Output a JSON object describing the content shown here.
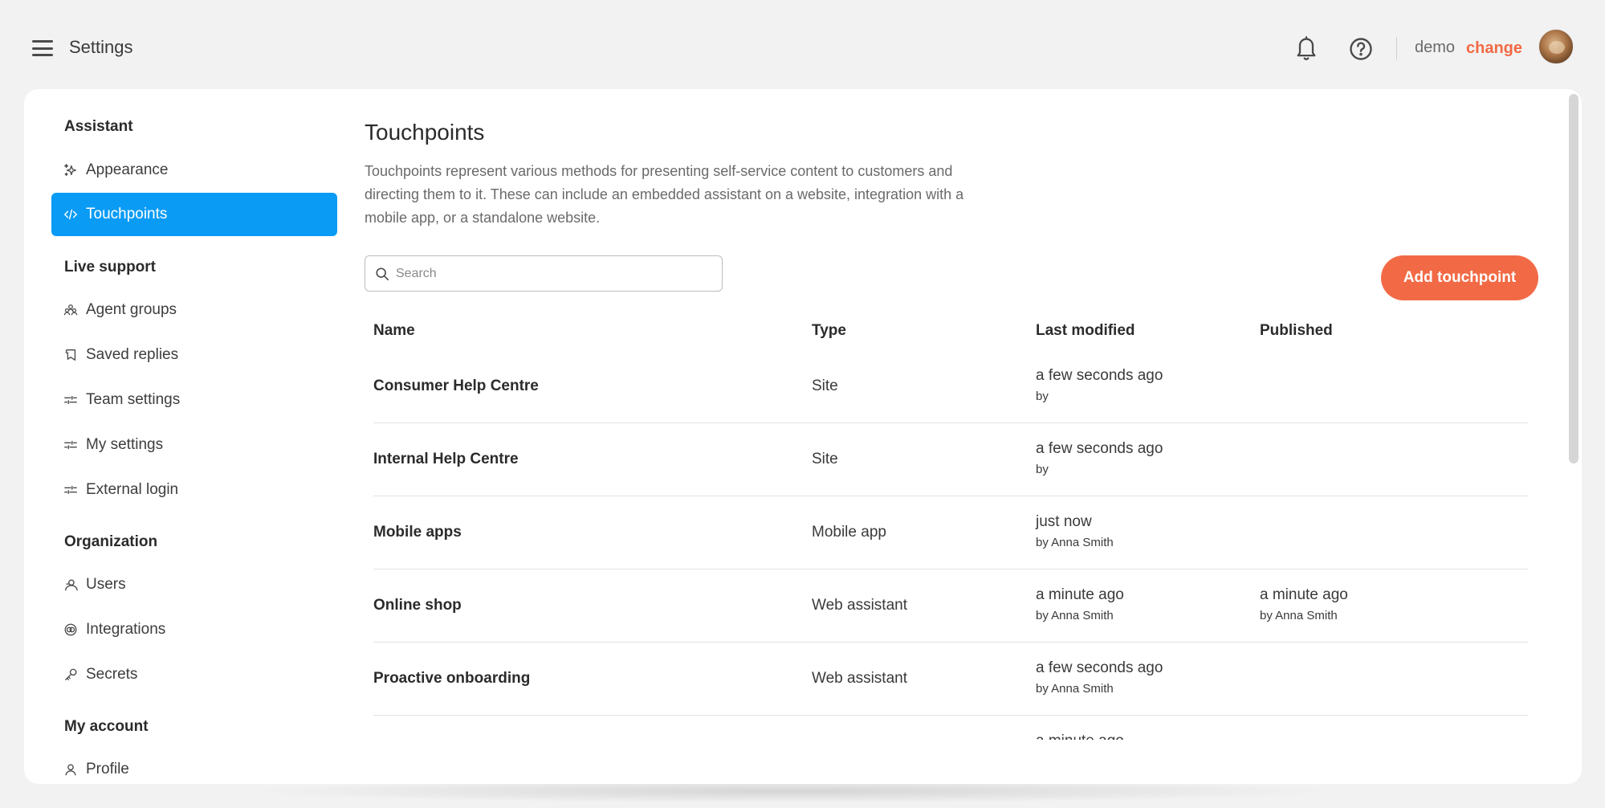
{
  "header": {
    "title": "Settings",
    "user_name": "demo",
    "change_label": "change"
  },
  "sidebar": {
    "sections": [
      {
        "title": "Assistant"
      },
      {
        "title": "Live support"
      },
      {
        "title": "Organization"
      },
      {
        "title": "My account"
      }
    ],
    "items": [
      {
        "label": "Appearance",
        "icon": "sparkle-icon"
      },
      {
        "label": "Touchpoints",
        "icon": "code-icon",
        "active": true
      },
      {
        "label": "Agent groups",
        "icon": "people-icon"
      },
      {
        "label": "Saved replies",
        "icon": "bookmark-icon"
      },
      {
        "label": "Team settings",
        "icon": "sliders-icon"
      },
      {
        "label": "My settings",
        "icon": "sliders-icon"
      },
      {
        "label": "External login",
        "icon": "sliders-icon"
      },
      {
        "label": "Users",
        "icon": "users-icon"
      },
      {
        "label": "Integrations",
        "icon": "integrations-icon"
      },
      {
        "label": "Secrets",
        "icon": "key-icon"
      },
      {
        "label": "Profile",
        "icon": "person-icon"
      }
    ]
  },
  "main": {
    "title": "Touchpoints",
    "description": "Touchpoints represent various methods for presenting self-service content to customers and directing them to it. These can include an embedded assistant on a website, integration with a mobile app, or a standalone website.",
    "search_placeholder": "Search",
    "add_button": "Add touchpoint",
    "table": {
      "columns": [
        "Name",
        "Type",
        "Last modified",
        "Published"
      ],
      "rows": [
        {
          "name": "Consumer Help Centre",
          "type": "Site",
          "modified": "a few seconds ago",
          "modified_by": "by",
          "published": "",
          "published_by": ""
        },
        {
          "name": "Internal Help Centre",
          "type": "Site",
          "modified": "a few seconds ago",
          "modified_by": "by",
          "published": "",
          "published_by": ""
        },
        {
          "name": "Mobile apps",
          "type": "Mobile app",
          "modified": "just now",
          "modified_by": "by Anna Smith",
          "published": "",
          "published_by": ""
        },
        {
          "name": "Online shop",
          "type": "Web assistant",
          "modified": "a minute ago",
          "modified_by": "by Anna Smith",
          "published": "a minute ago",
          "published_by": "by Anna Smith"
        },
        {
          "name": "Proactive onboarding",
          "type": "Web assistant",
          "modified": "a few seconds ago",
          "modified_by": "by Anna Smith",
          "published": "",
          "published_by": ""
        },
        {
          "name": "",
          "type": "",
          "modified": "a minute ago",
          "modified_by": "",
          "published": "",
          "published_by": ""
        }
      ]
    }
  },
  "colors": {
    "accent": "#0a9bf5",
    "brand": "#f26a45",
    "background": "#f2f2f2"
  }
}
